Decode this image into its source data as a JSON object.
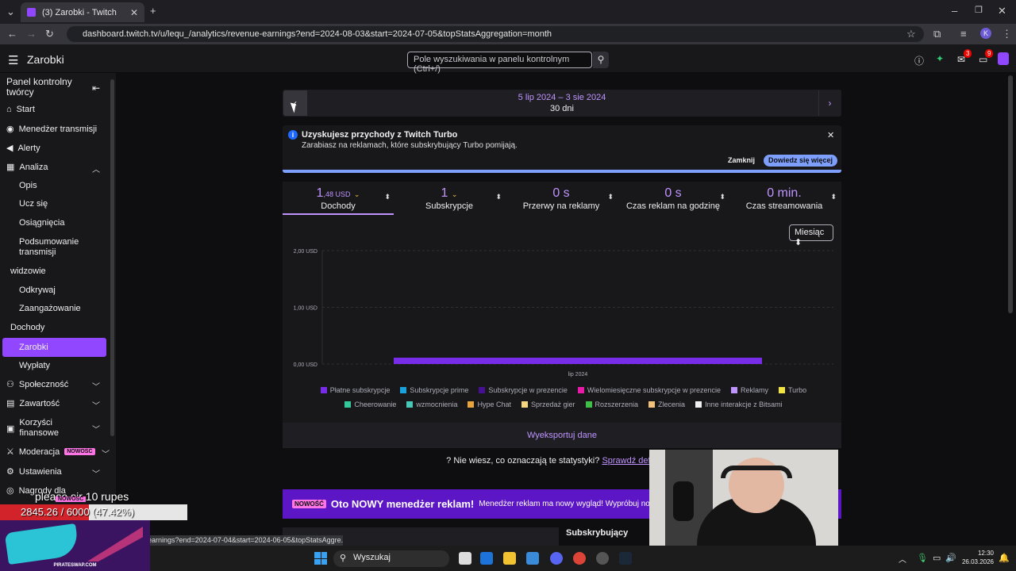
{
  "browser": {
    "tab_title": "(3) Zarobki - Twitch",
    "url": "dashboard.twitch.tv/u/lequ_/analytics/revenue-earnings?end=2024-08-03&start=2024-07-05&topStatsAggregation=month",
    "status_url": "e-earnings?end=2024-07-04&start=2024-06-05&topStatsAggre..."
  },
  "topbar": {
    "title": "Zarobki",
    "search_placeholder": "Pole wyszukiwania w panelu kontrolnym (Ctrl+/)",
    "badges": [
      "3",
      "9"
    ]
  },
  "sidebar": {
    "header": "Panel kontrolny twórcy",
    "items": [
      {
        "label": "Start",
        "icon": "home-icon"
      },
      {
        "label": "Menedżer transmisji",
        "icon": "broadcast-icon"
      },
      {
        "label": "Alerty",
        "icon": "megaphone-icon"
      },
      {
        "label": "Analiza",
        "icon": "analytics-icon"
      },
      {
        "label": "Opis"
      },
      {
        "label": "Ucz się"
      },
      {
        "label": "Osiągnięcia"
      },
      {
        "label": "Podsumowanie transmisji"
      },
      {
        "label": "widzowie"
      },
      {
        "label": "Odkrywaj"
      },
      {
        "label": "Zaangażowanie"
      },
      {
        "label": "Dochody"
      },
      {
        "label": "Zarobki"
      },
      {
        "label": "Wypłaty"
      },
      {
        "label": "Społeczność",
        "icon": "community-icon"
      },
      {
        "label": "Zawartość",
        "icon": "content-icon"
      },
      {
        "label": "Korzyści finansowe",
        "icon": "money-icon"
      },
      {
        "label": "Moderacja",
        "icon": "sword-icon",
        "badge": "NOWOŚĆ"
      },
      {
        "label": "Ustawienia",
        "icon": "gear-icon"
      },
      {
        "label": "Nagrody dla"
      }
    ]
  },
  "date_range": {
    "range": "5 lip 2024 – 3 sie 2024",
    "days": "30 dni"
  },
  "info_banner": {
    "title": "Uzyskujesz przychody z Twitch Turbo",
    "body": "Zarabiasz na reklamach, które subskrybujący Turbo pomijają.",
    "dismiss": "Zamknij",
    "learn_more": "Dowiedz się więcej"
  },
  "stats": [
    {
      "value": "1",
      "value_dec": ",48 USD",
      "label": "Dochody"
    },
    {
      "value": "1",
      "label": "Subskrypcje"
    },
    {
      "value": "0 s",
      "label": "Przerwy na reklamy"
    },
    {
      "value": "0 s",
      "label": "Czas reklam na godzinę"
    },
    {
      "value": "0 min.",
      "label": "Czas streamowania"
    }
  ],
  "period_select": "Miesiąc",
  "chart_data": {
    "type": "bar",
    "categories": [
      "lip 2024"
    ],
    "series": [
      {
        "name": "Płatne subskrypcje",
        "values": [
          0.05
        ]
      }
    ],
    "ylim": [
      0,
      2
    ],
    "yticks": [
      "0,00 USD",
      "1,00 USD",
      "2,00 USD"
    ],
    "grid": true,
    "legend_position": "bottom"
  },
  "legend": [
    {
      "name": "Płatne subskrypcje",
      "color": "#772ce8"
    },
    {
      "name": "Subskrypcje prime",
      "color": "#1aa1d9"
    },
    {
      "name": "Subskrypcje w prezencie",
      "color": "#451093"
    },
    {
      "name": "Wielomiesięczne subskrypcje w prezencie",
      "color": "#e91aa8"
    },
    {
      "name": "Reklamy",
      "color": "#bf94ff"
    },
    {
      "name": "Turbo",
      "color": "#f2e33d"
    },
    {
      "name": "Cheerowanie",
      "color": "#34c79b"
    },
    {
      "name": "wzmocnienia",
      "color": "#47c7b6"
    },
    {
      "name": "Hype Chat",
      "color": "#e8a33a"
    },
    {
      "name": "Sprzedaż gier",
      "color": "#f5d67e"
    },
    {
      "name": "Rozszerzenia",
      "color": "#3fbf46"
    },
    {
      "name": "Zlecenia",
      "color": "#f2c27a"
    },
    {
      "name": "Inne interakcje z Bitsami",
      "color": "#efeff1"
    }
  ],
  "export_label": "Wyeksportuj dane",
  "help": {
    "text": "Nie wiesz, co oznaczają te statystyki?",
    "link": "Sprawdź definicje p"
  },
  "ad_banner": {
    "badge": "NOWOŚĆ",
    "title": "Oto NOWY menedżer reklam!",
    "body": "Menedżer reklam ma nowy wygląd! Wypróbuj nowy sv"
  },
  "subs_label": "Subskrybujący",
  "overlay": {
    "goal_text": "please sir 10 rupes",
    "goal_value": "2845.26 / 6000 (47.42%)",
    "goal_progress": 0.4742,
    "new_tag": "NOWOŚĆ",
    "site": "PIRATESWAP.COM"
  },
  "taskbar": {
    "search": "Wyszukaj",
    "time": "12:30",
    "date": "26.03.2026"
  }
}
